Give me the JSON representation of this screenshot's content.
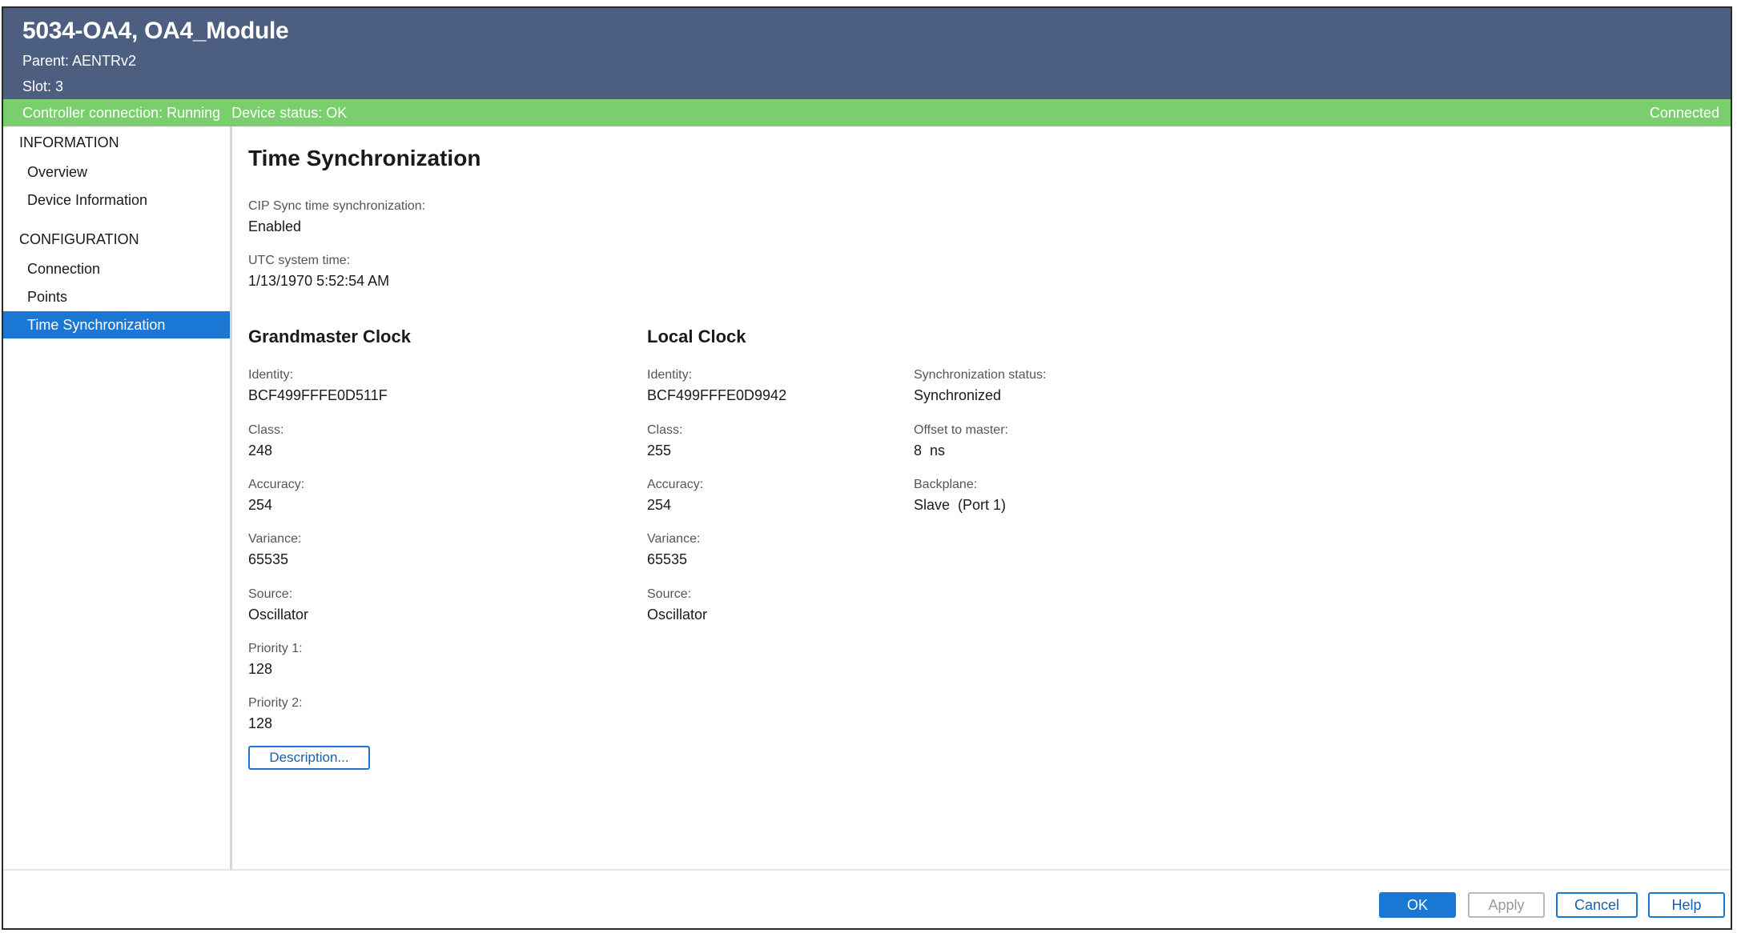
{
  "header": {
    "title": "5034-OA4, OA4_Module",
    "parent": "Parent:  AENTRv2",
    "slot": "Slot:  3"
  },
  "status": {
    "controller": "Controller connection:  Running",
    "device": "Device status:  OK",
    "connection": "Connected",
    "bar_color": "#79cf6b"
  },
  "sidebar": {
    "section1": "INFORMATION",
    "section2": "CONFIGURATION",
    "items": [
      {
        "label": "Overview"
      },
      {
        "label": "Device Information"
      },
      {
        "label": "Connection"
      },
      {
        "label": "Points"
      },
      {
        "label": "Time Synchronization",
        "active": true
      }
    ]
  },
  "main": {
    "title": "Time Synchronization",
    "cip_label": "CIP Sync time synchronization:",
    "cip_value": "Enabled",
    "utc_label": "UTC system time:",
    "utc_value": "1/13/1970 5:52:54 AM",
    "grandmaster": {
      "heading": "Grandmaster Clock",
      "identity_label": "Identity:",
      "identity": "BCF499FFFE0D511F",
      "class_label": "Class:",
      "class": "248",
      "accuracy_label": "Accuracy:",
      "accuracy": "254",
      "variance_label": "Variance:",
      "variance": "65535",
      "source_label": "Source:",
      "source": "Oscillator",
      "priority1_label": "Priority 1:",
      "priority1": "128",
      "priority2_label": "Priority 2:",
      "priority2": "128"
    },
    "local": {
      "heading": "Local Clock",
      "identity_label": "Identity:",
      "identity": "BCF499FFFE0D9942",
      "class_label": "Class:",
      "class": "255",
      "accuracy_label": "Accuracy:",
      "accuracy": "254",
      "variance_label": "Variance:",
      "variance": "65535",
      "source_label": "Source:",
      "source": "Oscillator"
    },
    "sync": {
      "status_label": "Synchronization status:",
      "status": "Synchronized",
      "offset_label": "Offset to master:",
      "offset": "8  ns",
      "backplane_label": "Backplane:",
      "backplane": "Slave  (Port 1)"
    },
    "description_button": "Description..."
  },
  "footer": {
    "ok": "OK",
    "apply": "Apply",
    "cancel": "Cancel",
    "help": "Help"
  },
  "colors": {
    "header": "#4c5f80",
    "accent": "#1a78d4",
    "status_ok": "#79cf6b"
  }
}
